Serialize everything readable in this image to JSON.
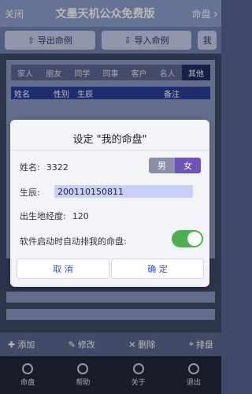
{
  "app": {
    "close_label": "关闭",
    "title": "文墨天机公众免费版",
    "right_label": "命盘",
    "right_icon": "chevron-right-icon"
  },
  "actions": {
    "export_label": "导出命例",
    "import_label": "导入命例",
    "more_label": "我"
  },
  "categories": [
    "家人",
    "朋友",
    "同学",
    "同事",
    "客户",
    "名人",
    "其他"
  ],
  "active_category": "其他",
  "table_header": [
    "姓名",
    "性别",
    "生辰",
    "备注"
  ],
  "modal": {
    "title": "设定 \"我的命盘\"",
    "name_label": "姓名:",
    "name_value": "3322",
    "gender_male": "男",
    "gender_female": "女",
    "selected_gender": "女",
    "birth_label": "生辰:",
    "birth_value": "200110150811",
    "place_label": "出生地经度:",
    "place_value": "120",
    "auto_label": "软件启动时自动排我的命盘:",
    "auto_enabled": true,
    "cancel_label": "取 消",
    "confirm_label": "确 定"
  },
  "bottom_actions": {
    "add": "添加",
    "edit": "修改",
    "delete": "删除",
    "arrange": "排盘"
  },
  "tabs": [
    "命盘",
    "帮助",
    "关于",
    "退出"
  ],
  "colors": {
    "accent": "#2f56c6",
    "toggle_on": "#4caf50",
    "gender_selected": "#6d54b6"
  }
}
